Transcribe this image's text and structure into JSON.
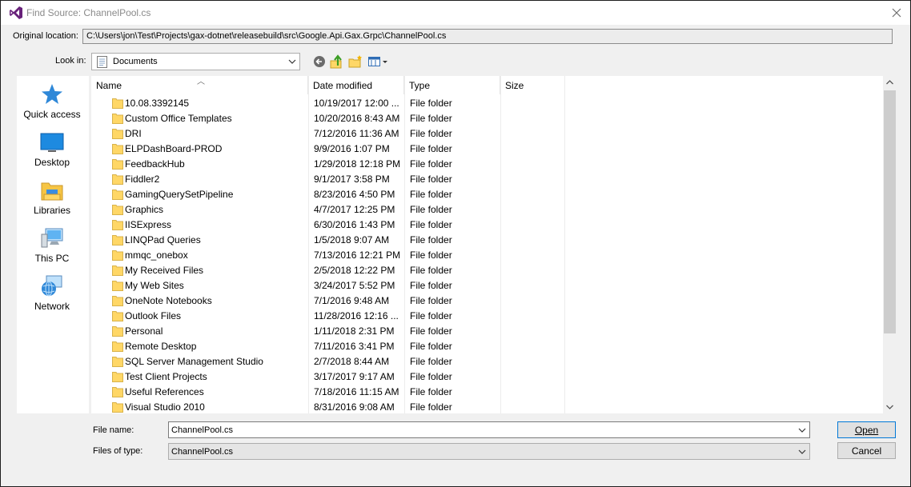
{
  "window": {
    "title": "Find Source: ChannelPool.cs"
  },
  "original_location": {
    "label": "Original location:",
    "value": "C:\\Users\\jon\\Test\\Projects\\gax-dotnet\\releasebuild\\src\\Google.Api.Gax.Grpc\\ChannelPool.cs"
  },
  "look_in": {
    "label": "Look in:",
    "value": "Documents"
  },
  "places": [
    {
      "label": "Quick access",
      "icon": "star-icon"
    },
    {
      "label": "Desktop",
      "icon": "desktop-icon"
    },
    {
      "label": "Libraries",
      "icon": "libraries-icon"
    },
    {
      "label": "This PC",
      "icon": "computer-icon"
    },
    {
      "label": "Network",
      "icon": "network-icon"
    }
  ],
  "columns": {
    "name": "Name",
    "date": "Date modified",
    "type": "Type",
    "size": "Size"
  },
  "files": [
    {
      "name": "10.08.3392145",
      "date": "10/19/2017 12:00 ...",
      "type": "File folder"
    },
    {
      "name": "Custom Office Templates",
      "date": "10/20/2016 8:43 AM",
      "type": "File folder"
    },
    {
      "name": "DRI",
      "date": "7/12/2016 11:36 AM",
      "type": "File folder"
    },
    {
      "name": "ELPDashBoard-PROD",
      "date": "9/9/2016 1:07 PM",
      "type": "File folder"
    },
    {
      "name": "FeedbackHub",
      "date": "1/29/2018 12:18 PM",
      "type": "File folder"
    },
    {
      "name": "Fiddler2",
      "date": "9/1/2017 3:58 PM",
      "type": "File folder"
    },
    {
      "name": "GamingQuerySetPipeline",
      "date": "8/23/2016 4:50 PM",
      "type": "File folder"
    },
    {
      "name": "Graphics",
      "date": "4/7/2017 12:25 PM",
      "type": "File folder"
    },
    {
      "name": "IISExpress",
      "date": "6/30/2016 1:43 PM",
      "type": "File folder"
    },
    {
      "name": "LINQPad Queries",
      "date": "1/5/2018 9:07 AM",
      "type": "File folder"
    },
    {
      "name": "mmqc_onebox",
      "date": "7/13/2016 12:21 PM",
      "type": "File folder"
    },
    {
      "name": "My Received Files",
      "date": "2/5/2018 12:22 PM",
      "type": "File folder"
    },
    {
      "name": "My Web Sites",
      "date": "3/24/2017 5:52 PM",
      "type": "File folder"
    },
    {
      "name": "OneNote Notebooks",
      "date": "7/1/2016 9:48 AM",
      "type": "File folder"
    },
    {
      "name": "Outlook Files",
      "date": "11/28/2016 12:16 ...",
      "type": "File folder"
    },
    {
      "name": "Personal",
      "date": "1/11/2018 2:31 PM",
      "type": "File folder"
    },
    {
      "name": "Remote Desktop",
      "date": "7/11/2016 3:41 PM",
      "type": "File folder"
    },
    {
      "name": "SQL Server Management Studio",
      "date": "2/7/2018 8:44 AM",
      "type": "File folder"
    },
    {
      "name": "Test Client Projects",
      "date": "3/17/2017 9:17 AM",
      "type": "File folder"
    },
    {
      "name": "Useful References",
      "date": "7/18/2016 11:15 AM",
      "type": "File folder"
    },
    {
      "name": "Visual Studio 2010",
      "date": "8/31/2016 9:08 AM",
      "type": "File folder"
    }
  ],
  "file_name": {
    "label": "File name:",
    "value": "ChannelPool.cs"
  },
  "file_type": {
    "label": "Files of type:",
    "value": "ChannelPool.cs"
  },
  "buttons": {
    "open": "Open",
    "cancel": "Cancel"
  },
  "colors": {
    "folder": "#ffd766",
    "accent": "#0078d7",
    "vs_purple": "#68217a"
  }
}
